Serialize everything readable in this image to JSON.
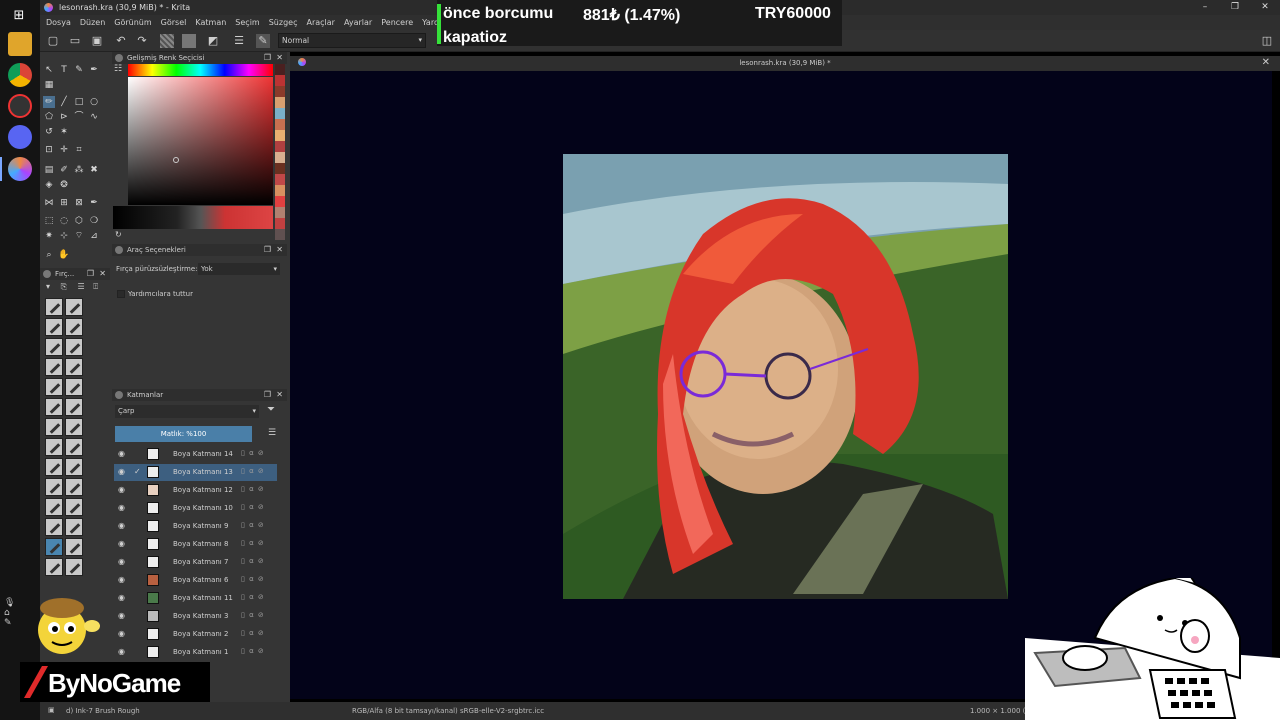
{
  "window": {
    "title": "lesonrash.kra (30,9 MiB) * - Krita"
  },
  "menu": [
    "Dosya",
    "Düzen",
    "Görünüm",
    "Görsel",
    "Katman",
    "Seçim",
    "Süzgeç",
    "Araçlar",
    "Ayarlar",
    "Pencere",
    "Yardım"
  ],
  "toolbar": {
    "blend_mode": "Normal"
  },
  "ticker": {
    "line1": "önce borcumu",
    "value": "881₺ (1.47%)",
    "total": "TRY60000",
    "line2": "kapatioz"
  },
  "panels": {
    "color_selector": "Gelişmiş Renk Seçicisi",
    "tool_options": "Araç Seçenekleri",
    "brushes": "Fırç...",
    "layers": "Katmanlar"
  },
  "tool_options": {
    "smoothing_label": "Fırça pürüzsüzleştirme:",
    "smoothing_value": "Yok",
    "assistant_label": "Yardımcılara tuttur"
  },
  "layers": {
    "blend_mode": "Çarp",
    "opacity_label": "Matlık: %100",
    "items": [
      {
        "name": "Boya Katmanı 14",
        "selected": false
      },
      {
        "name": "Boya Katmanı 13",
        "selected": true
      },
      {
        "name": "Boya Katmanı 12",
        "selected": false
      },
      {
        "name": "Boya Katmanı 10",
        "selected": false
      },
      {
        "name": "Boya Katmanı 9",
        "selected": false
      },
      {
        "name": "Boya Katmanı 8",
        "selected": false
      },
      {
        "name": "Boya Katmanı 7",
        "selected": false
      },
      {
        "name": "Boya Katmanı 6",
        "selected": false
      },
      {
        "name": "Boya Katmanı 11",
        "selected": false
      },
      {
        "name": "Boya Katmanı 3",
        "selected": false
      },
      {
        "name": "Boya Katmanı 2",
        "selected": false
      },
      {
        "name": "Boya Katmanı 1",
        "selected": false
      }
    ]
  },
  "canvas": {
    "document_title": "lesonrash.kra (30,9 MiB) *"
  },
  "status": {
    "brush": "d) Ink-7 Brush Rough",
    "color_profile": "RGB/Alfa (8 bit tamsayı/kanal) sRGB-elle-V2-srgbtrc.icc",
    "size": "1.000 × 1.000 (3"
  },
  "overlay": {
    "brand": "ByNoGame"
  },
  "colors": {
    "accent": "#4a7fa8",
    "canvas_bg": "#030319",
    "ticker_bar": "#36e13a"
  }
}
